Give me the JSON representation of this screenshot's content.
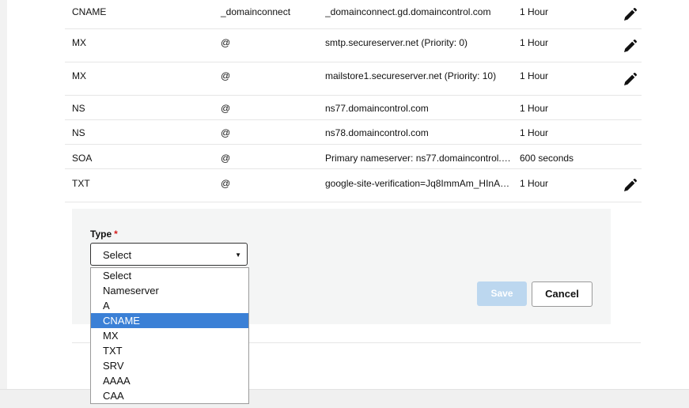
{
  "records": [
    {
      "type": "CNAME",
      "name": "_domainconnect",
      "value": "_domainconnect.gd.domaincontrol.com",
      "ttl": "1 Hour",
      "editable": true
    },
    {
      "type": "MX",
      "name": "@",
      "value": "smtp.secureserver.net (Priority: 0)",
      "ttl": "1 Hour",
      "editable": true
    },
    {
      "type": "MX",
      "name": "@",
      "value": "mailstore1.secureserver.net (Priority: 10)",
      "ttl": "1 Hour",
      "editable": true
    },
    {
      "type": "NS",
      "name": "@",
      "value": "ns77.domaincontrol.com",
      "ttl": "1 Hour",
      "editable": false
    },
    {
      "type": "NS",
      "name": "@",
      "value": "ns78.domaincontrol.com",
      "ttl": "1 Hour",
      "editable": false
    },
    {
      "type": "SOA",
      "name": "@",
      "value": "Primary nameserver: ns77.domaincontrol.co...",
      "ttl": "600 seconds",
      "editable": false
    },
    {
      "type": "TXT",
      "name": "@",
      "value": "google-site-verification=Jq8ImmAm_HInA_...",
      "ttl": "1 Hour",
      "editable": true
    }
  ],
  "form": {
    "type_label": "Type",
    "required_mark": "*",
    "select_value": "Select",
    "save_label": "Save",
    "cancel_label": "Cancel"
  },
  "dropdown": {
    "options": [
      "Select",
      "Nameserver",
      "A",
      "CNAME",
      "MX",
      "TXT",
      "SRV",
      "AAAA",
      "CAA"
    ],
    "highlighted": "CNAME"
  },
  "colors": {
    "highlight": "#3b80d6",
    "save_disabled": "#bcd7ef",
    "required": "#d41c1c"
  },
  "icons": {
    "edit": "pencil-icon",
    "select_arrow": "triangle-down-icon"
  }
}
